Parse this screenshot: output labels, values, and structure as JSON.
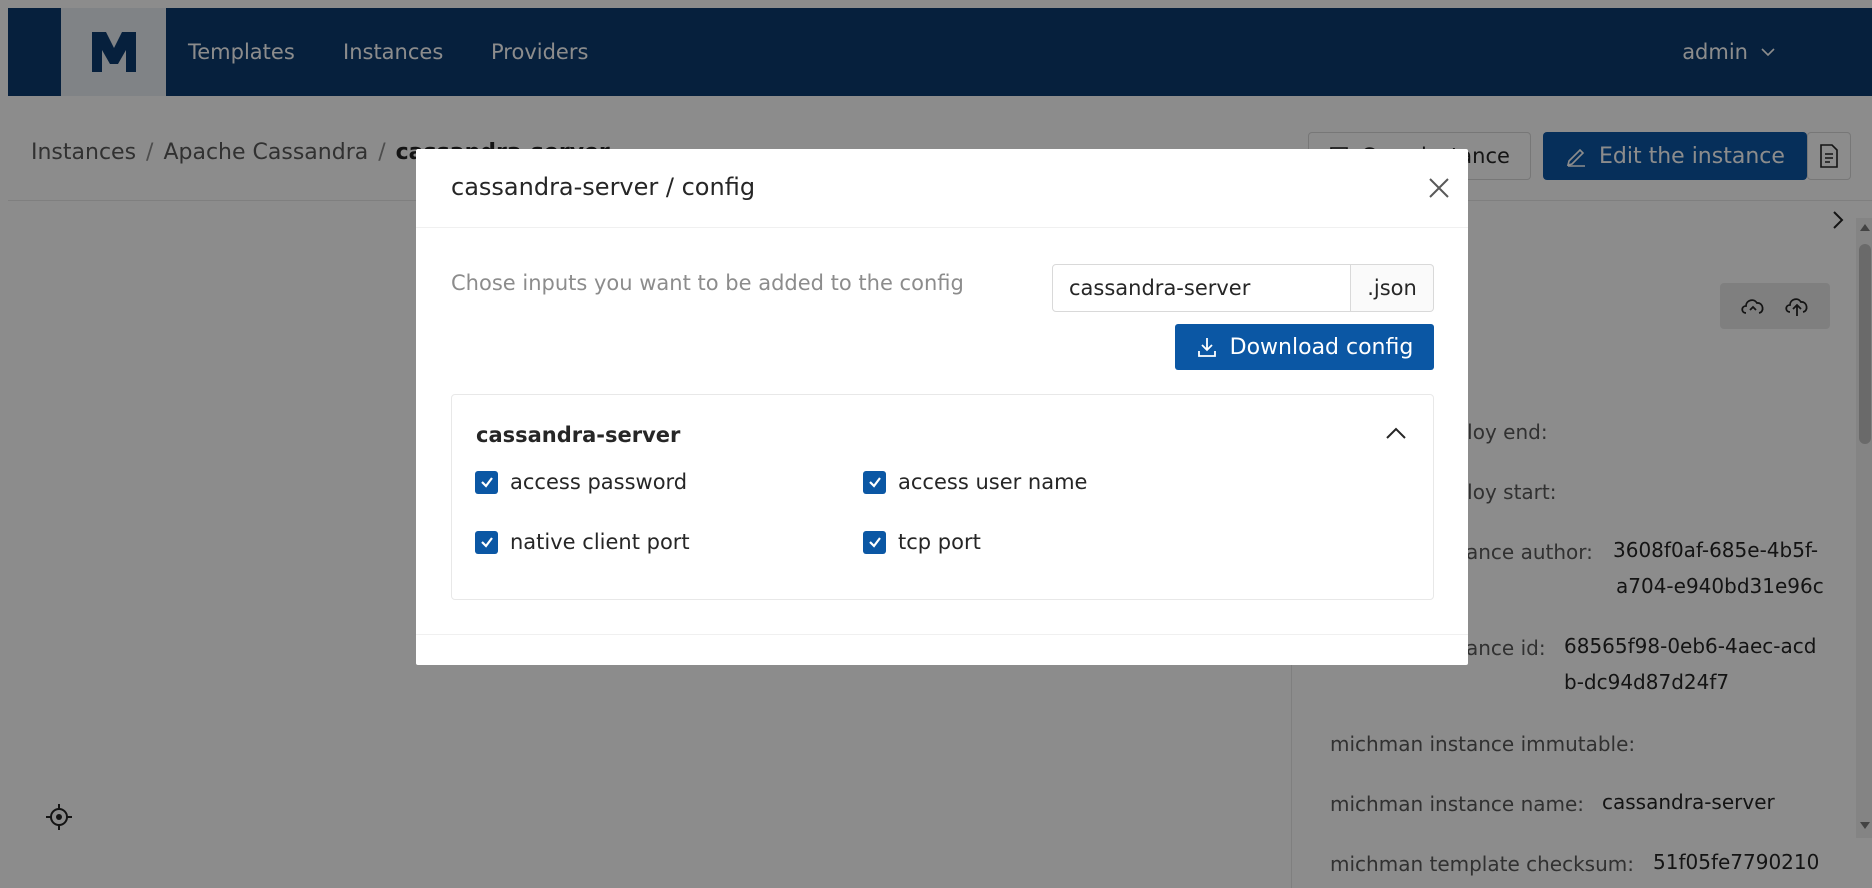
{
  "nav": {
    "logo_label": "M",
    "items": [
      "Templates",
      "Instances",
      "Providers"
    ],
    "user": "admin"
  },
  "breadcrumb": {
    "items": [
      "Instances",
      "Apache Cassandra"
    ],
    "current": "cassandra-server",
    "separator": "/"
  },
  "toolbar": {
    "copy_label": "Copy instance",
    "edit_label": "Edit the instance"
  },
  "properties": [
    {
      "label": "michman deploy end:",
      "value": ""
    },
    {
      "label": "michman deploy start:",
      "value": ""
    },
    {
      "label": "michman instance author:",
      "value_lines": [
        "3608f0af-685e-4b5f-",
        "a704-e940bd31e96c"
      ]
    },
    {
      "label": "michman instance id:",
      "value_lines": [
        "68565f98-0eb6-4aec-acd",
        "b-dc94d87d24f7"
      ]
    },
    {
      "label": "michman instance immutable:",
      "value": ""
    },
    {
      "label": "michman instance name:",
      "value": "cassandra-server"
    },
    {
      "label": "michman template checksum:",
      "value": "51f05fe7790210"
    }
  ],
  "modal": {
    "title": "cassandra-server / config",
    "hint": "Chose inputs you want to be added to the config",
    "filename": "cassandra-server",
    "extension": ".json",
    "download_label": "Download config",
    "section": {
      "title": "cassandra-server",
      "options": [
        {
          "label": "access password",
          "checked": true
        },
        {
          "label": "access user name",
          "checked": true
        },
        {
          "label": "native client port",
          "checked": true
        },
        {
          "label": "tcp port",
          "checked": true
        }
      ]
    }
  },
  "colors": {
    "navbar": "#0b3b6f",
    "primary": "#0b57a4",
    "overlay": "rgba(0,0,0,0.45)"
  }
}
